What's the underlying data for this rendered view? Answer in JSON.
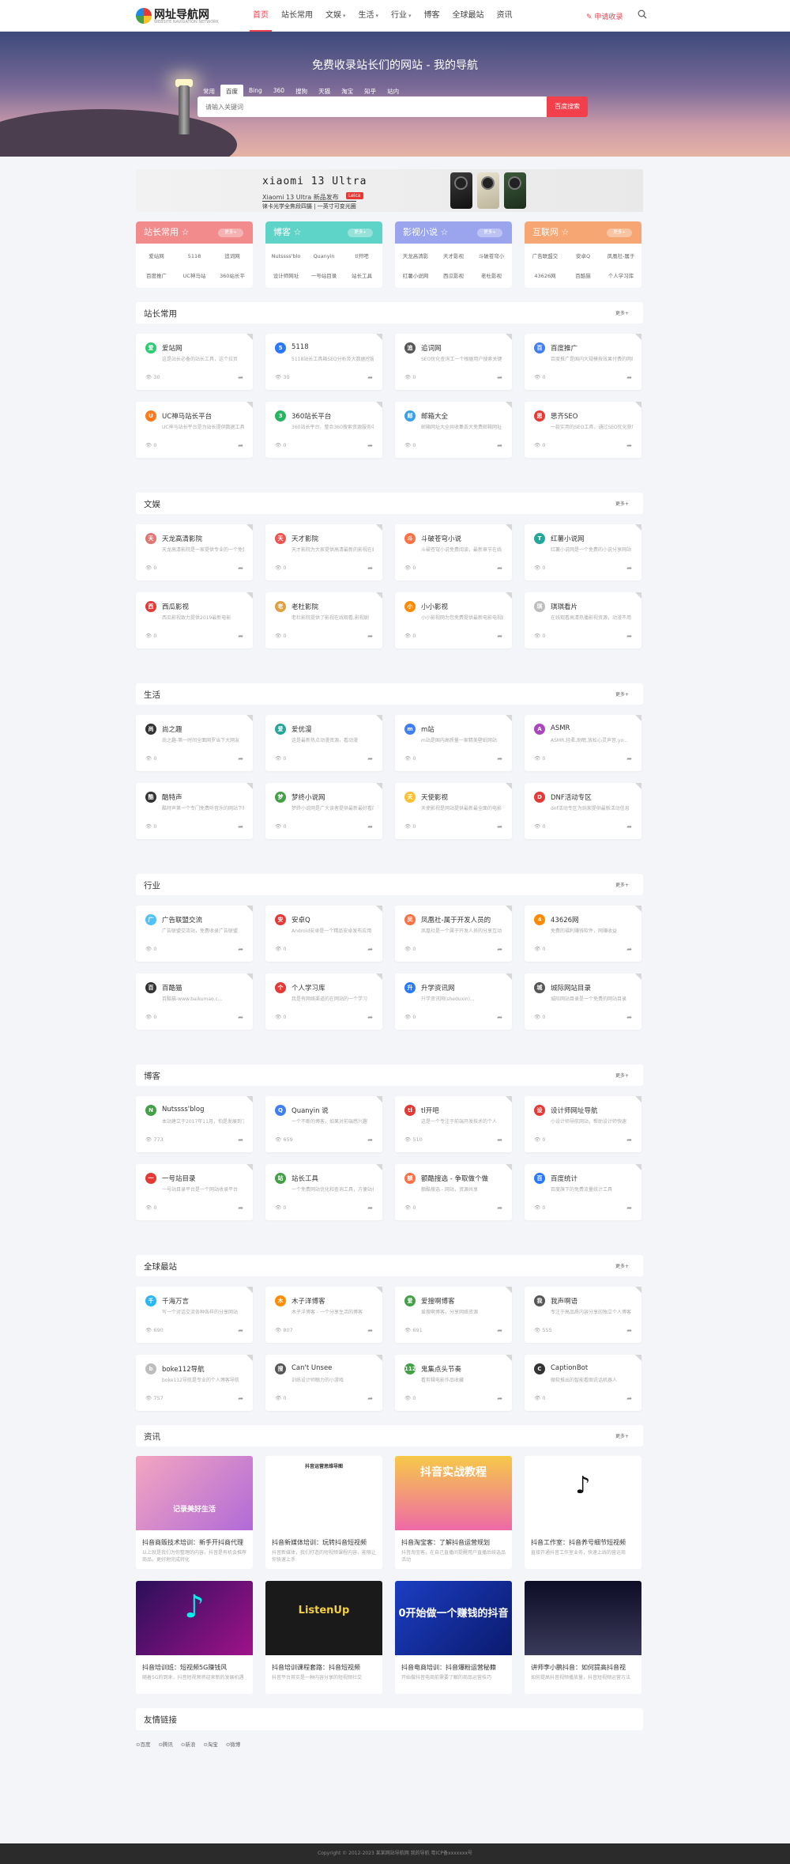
{
  "header": {
    "logo_title": "网址导航网",
    "logo_sub": "WEBSITE NAVIGATION NETWORK",
    "apply": "✎ 申请收录",
    "menu": [
      {
        "label": "首页",
        "active": true,
        "caret": false
      },
      {
        "label": "站长常用",
        "caret": false
      },
      {
        "label": "文娱",
        "caret": true
      },
      {
        "label": "生活",
        "caret": true
      },
      {
        "label": "行业",
        "caret": true
      },
      {
        "label": "博客",
        "caret": false
      },
      {
        "label": "全球最站",
        "caret": false
      },
      {
        "label": "资讯",
        "caret": false
      }
    ]
  },
  "hero": {
    "title": "免费收录站长们的网站 - 我的导航",
    "tabs": [
      "常用",
      "百度",
      "Bing",
      "360",
      "搜狗",
      "天猫",
      "淘宝",
      "知乎",
      "站内"
    ],
    "active_tab": "百度",
    "placeholder": "请输入关键词",
    "button": "百度搜索"
  },
  "banner": {
    "brand": "xiaomi 13 Ultra",
    "tag": "Leica",
    "slogan": "徕卡光学全焦段四摄 | 一英寸可变光圈",
    "sub": "Xiaomi 13 Ultra 新品发布"
  },
  "categories": [
    {
      "title": "站长常用 ☆",
      "more": "更多+",
      "color": "#f28b8b",
      "items": [
        "爱站网",
        "5118",
        "追词网",
        "百度推广",
        "UC神马站",
        "360站长平"
      ]
    },
    {
      "title": "博客 ☆",
      "more": "更多+",
      "color": "#5ed3c7",
      "items": [
        "Nutssss'blo",
        "Quanyin",
        "tl开吧",
        "设计师网址",
        "一号站目录",
        "站长工具"
      ]
    },
    {
      "title": "影视小说 ☆",
      "more": "更多+",
      "color": "#9aa5ee",
      "items": [
        "天龙高清影",
        "天才影视",
        "斗破苍穹小",
        "红薯小说网",
        "西瓜影视",
        "老杜影视"
      ]
    },
    {
      "title": "互联网 ☆",
      "more": "更多+",
      "color": "#f5a673",
      "items": [
        "广告联盟交",
        "安卓Q",
        "凤凰社-属于",
        "43626网",
        "百酷猫",
        "个人学习库"
      ]
    }
  ],
  "sections": [
    {
      "title": "站长常用",
      "more": "更多+",
      "cards": [
        {
          "name": "爱站网",
          "desc": "这是站长必备的站长工具，这个拉页",
          "views": "30",
          "color": "#2ecc71",
          "icon": "爱"
        },
        {
          "name": "5118",
          "desc": "5118站长工具箱SEO分析及大数据挖掘",
          "views": "30",
          "color": "#2979ff",
          "icon": "5"
        },
        {
          "name": "追词网",
          "desc": "SEO优化查询工一个根据用户搜索关键",
          "views": "0",
          "color": "#555555",
          "icon": "追"
        },
        {
          "name": "百度推广",
          "desc": "百度推广是国内大规模按效果付费的网络推",
          "views": "0",
          "color": "#3f7ef5",
          "icon": "百"
        },
        {
          "name": "UC神马站长平台",
          "desc": "UC神马站长平台是为站长提供数据工具",
          "views": "0",
          "color": "#ff7a1a",
          "icon": "U"
        },
        {
          "name": "360站长平台",
          "desc": "360站长平台，整合360搜索资源服务中心",
          "views": "0",
          "color": "#28b463",
          "icon": "3"
        },
        {
          "name": "邮箱大全",
          "desc": "邮箱网址大全共收集各大免费邮箱网址",
          "views": "0",
          "color": "#3aa0e8",
          "icon": "邮"
        },
        {
          "name": "思齐SEO",
          "desc": "一款实用的SEO工具，通过SEO优化获取流量",
          "views": "0",
          "color": "#e53935",
          "icon": "思"
        }
      ]
    },
    {
      "title": "文娱",
      "more": "更多+",
      "cards": [
        {
          "name": "天龙高清影院",
          "desc": "天龙高清影院是一家提供专业的一个免费",
          "views": "0",
          "color": "#e57373",
          "icon": "天"
        },
        {
          "name": "天才影院",
          "desc": "天才影院为大家提供高清最新的影视在线",
          "views": "0",
          "color": "#ef5350",
          "icon": "天"
        },
        {
          "name": "斗破苍穹小说",
          "desc": "斗破苍穹小说免费阅读，最新章节在线",
          "views": "0",
          "color": "#ff7043",
          "icon": "斗"
        },
        {
          "name": "红薯小说网",
          "desc": "红薯小说网是一个免费的小说分享网站",
          "views": "0",
          "color": "#26a69a",
          "icon": "T"
        },
        {
          "name": "西瓜影视",
          "desc": "西瓜影视致力提供2019最新电影",
          "views": "0",
          "color": "#e53935",
          "icon": "西"
        },
        {
          "name": "老杜影院",
          "desc": "老杜影院提供了影视在线观看,影视剧",
          "views": "0",
          "color": "#e0a040",
          "icon": "老"
        },
        {
          "name": "小小影视",
          "desc": "小小影视网为您免费提供最新电影电视剧",
          "views": "0",
          "color": "#ff8a00",
          "icon": "小"
        },
        {
          "name": "琪琪看片",
          "desc": "在线观看高清热播影视资源，动漫不用",
          "views": "0",
          "color": "#bdbdbd",
          "icon": "琪"
        }
      ]
    },
    {
      "title": "生活",
      "more": "更多+",
      "cards": [
        {
          "name": "尚之趣",
          "desc": "尚之趣-第一时间全面网罗当下大网友",
          "views": "0",
          "color": "#333333",
          "icon": "尚"
        },
        {
          "name": "爱优漫",
          "desc": "这是最新热点动漫资源，看动漫",
          "views": "0",
          "color": "#26a69a",
          "icon": "爱"
        },
        {
          "name": "m站",
          "desc": "m站是国内高质量一家精美壁纸网站",
          "views": "0",
          "color": "#3f7ef5",
          "icon": "m"
        },
        {
          "name": "ASMR",
          "desc": "ASMR,轻柔,助眠,放松心灵声音,yo...",
          "views": "0",
          "color": "#ab47bc",
          "icon": "A"
        },
        {
          "name": "酷特声",
          "desc": "酷特声第一个专门免费听音乐的网站下载",
          "views": "0",
          "color": "#333333",
          "icon": "酷"
        },
        {
          "name": "梦终小说网",
          "desc": "梦终小说网是广大读者提供最新最好看的",
          "views": "0",
          "color": "#43a047",
          "icon": "梦"
        },
        {
          "name": "天使影视",
          "desc": "天使影视是网站提供最新最全面的电影",
          "views": "0",
          "color": "#fbc02d",
          "icon": "天"
        },
        {
          "name": "DNF活动专区",
          "desc": "dnf活动专区为玩家提供最新活动信息",
          "views": "0",
          "color": "#e53935",
          "icon": "D"
        }
      ]
    },
    {
      "title": "行业",
      "more": "更多+",
      "cards": [
        {
          "name": "广告联盟交流",
          "desc": "广告联盟交流站，免费收录广告联盟",
          "views": "0",
          "color": "#4fc3f7",
          "icon": "广"
        },
        {
          "name": "安卓Q",
          "desc": "Android安卓是一个精品安卓发布应用",
          "views": "0",
          "color": "#e53935",
          "icon": "安"
        },
        {
          "name": "凤凰社-属于开发人员的",
          "desc": "凤凰社是一个属于开发人员的分享互动",
          "views": "0",
          "color": "#ff7043",
          "icon": "凤"
        },
        {
          "name": "43626网",
          "desc": "免费的福利赚钱软件，网赚收益",
          "views": "0",
          "color": "#ff8a00",
          "icon": "4"
        },
        {
          "name": "百酷猫",
          "desc": "百酷猫-www.baikumao.c...",
          "views": "0",
          "color": "#333333",
          "icon": "百"
        },
        {
          "name": "个人学习库",
          "desc": "我是有网络渠道的在网站的一个学习",
          "views": "0",
          "color": "#e53935",
          "icon": "个"
        },
        {
          "name": "升学资讯网",
          "desc": "升学资讯网(sheduxin)...",
          "views": "0",
          "color": "#2979ff",
          "icon": "升"
        },
        {
          "name": "城际网站目录",
          "desc": "城际网站目录是一个免费的网站目录",
          "views": "0",
          "color": "#555555",
          "icon": "城"
        }
      ]
    },
    {
      "title": "博客",
      "more": "更多+",
      "cards": [
        {
          "name": "Nutssss'blog",
          "desc": "本站建立于2017年11月，怕是发展到了",
          "views": "773",
          "color": "#43a047",
          "icon": "N"
        },
        {
          "name": "Quanyin 说",
          "desc": "一个不断的博客，如果对前端感兴趣",
          "views": "659",
          "color": "#3f7ef5",
          "icon": "Q"
        },
        {
          "name": "tl开吧",
          "desc": "这是一个专注于前端开发技术的个人",
          "views": "510",
          "color": "#e53935",
          "icon": "tl"
        },
        {
          "name": "设计师网址导航",
          "desc": "小设计师导航网站，帮助设计师快速",
          "views": "0",
          "color": "#e53935",
          "icon": "设"
        },
        {
          "name": "一号站目录",
          "desc": "一号站目录平台是一个网站收录平台",
          "views": "0",
          "color": "#e53935",
          "icon": "一"
        },
        {
          "name": "站长工具",
          "desc": "一个免费网站优化和查询工具，方便站长",
          "views": "0",
          "color": "#43a047",
          "icon": "站"
        },
        {
          "name": "额酷搜选 - 争取做个做",
          "desc": "额酷搜选 - 网站，资源共享",
          "views": "0",
          "color": "#ff7043",
          "icon": "额"
        },
        {
          "name": "百度统计",
          "desc": "百度旗下的免费流量统计工具",
          "views": "0",
          "color": "#2979ff",
          "icon": "百"
        }
      ]
    },
    {
      "title": "全球最站",
      "more": "更多+",
      "cards": [
        {
          "name": "千海万言",
          "desc": "写一个对话交流各种各样的分享网站",
          "views": "690",
          "color": "#29b6f6",
          "icon": "千"
        },
        {
          "name": "木子洋博客",
          "desc": "木子洋博客 - 一个分享生活的博客",
          "views": "807",
          "color": "#ff8a00",
          "icon": "木"
        },
        {
          "name": "爱搜啊博客",
          "desc": "爱搜啊博客，分享网络资源",
          "views": "691",
          "color": "#43a047",
          "icon": "爱"
        },
        {
          "name": "我声啊语",
          "desc": "专注于高品质内容分享的独立个人博客",
          "views": "555",
          "color": "#555555",
          "icon": "我"
        },
        {
          "name": "boke112导航",
          "desc": "boke112导航是专业的个人博客导航",
          "views": "757",
          "color": "#bdbdbd",
          "icon": "b"
        },
        {
          "name": "Can't Unsee",
          "desc": "训练设计师眼力的小游戏",
          "views": "0",
          "color": "#555555",
          "icon": "搜"
        },
        {
          "name": "鬼集点头节奏",
          "desc": "看剪辑电影作品收藏",
          "views": "0",
          "color": "#43a047",
          "icon": "112"
        },
        {
          "name": "CaptionBot",
          "desc": "微软推出的智能看图说话机器人",
          "views": "0",
          "color": "#333333",
          "icon": "C"
        }
      ]
    }
  ],
  "news": {
    "title": "资讯",
    "more": "更多+",
    "items": [
      {
        "title": "抖音商贩技术培训：新手开抖商代理",
        "desc": "以上就是我们为你整理的内容，抖音是有机会推荐商品，更好地完成转化",
        "img_text": "记录美好生活"
      },
      {
        "title": "抖音新媒体培训：玩转抖音短视频",
        "desc": "抖音新媒体，我们打造的短视频课程内容，能够让你快速上手",
        "img_text": "抖音运营思维导图"
      },
      {
        "title": "抖音淘宝客：了解抖音运营规划",
        "desc": "抖音淘宝客，在自己直播间提醒用户直播后续选品活动",
        "img_text": "抖音实战教程"
      },
      {
        "title": "抖音工作室：抖音养号细节短视频",
        "desc": "直接开通抖音工作室业务，快速上线的营运商",
        "img_text": "♪"
      },
      {
        "title": "抖音培训班：短视频5G赚钱风",
        "desc": "随着5G的到来，抖音短视频将迎来新的发展机遇",
        "img_text": "♪"
      },
      {
        "title": "抖音培训课程套路：抖音短视频",
        "desc": "抖音平台其实是一种内容分享的短视频社交",
        "img_text": "ListenUp"
      },
      {
        "title": "抖音电商培训：抖音爆粉运营秘籍",
        "desc": "开始做抖音电商前需要了解的商品运营技巧",
        "img_text": "0开始做一个赚钱的抖音"
      },
      {
        "title": "讲师李小鹏抖音：如何提高抖音视",
        "desc": "如何提高抖音视频播放量，抖音短视频运营方法",
        "img_text": ""
      }
    ]
  },
  "friends": {
    "title": "友情链接",
    "items": [
      "⊙百度",
      "⊙腾讯",
      "⊙新浪",
      "⊙淘宝",
      "⊙微博"
    ]
  },
  "footer": "Copyright © 2012-2023 某某网站导航网 我的导航   粤ICP备xxxxxxx号"
}
